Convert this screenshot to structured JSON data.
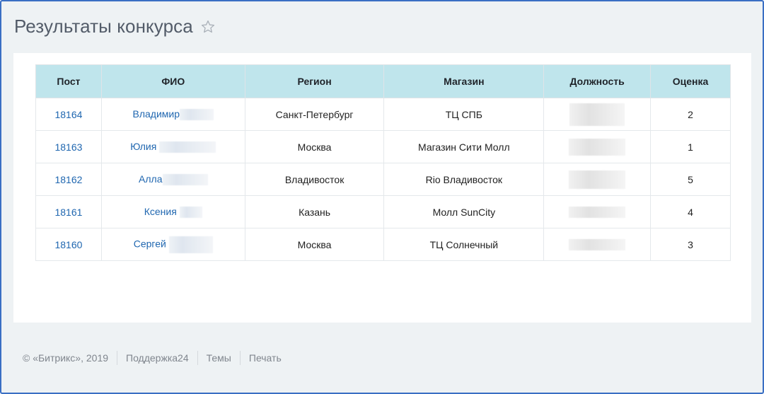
{
  "page": {
    "title": "Результаты конкурса",
    "favorite_icon": "star-outline-icon"
  },
  "table": {
    "columns": [
      "Пост",
      "ФИО",
      "Регион",
      "Магазин",
      "Должность",
      "Оценка"
    ],
    "rows": [
      {
        "post": "18164",
        "name": "Владимир",
        "region": "Санкт-Петербург",
        "store": "ТЦ СПБ",
        "score": "2"
      },
      {
        "post": "18163",
        "name": "Юлия",
        "region": "Москва",
        "store": "Магазин Сити Молл",
        "score": "1"
      },
      {
        "post": "18162",
        "name": "Алла",
        "region": "Владивосток",
        "store": "Rio Владивосток",
        "score": "5"
      },
      {
        "post": "18161",
        "name": "Ксения",
        "region": "Казань",
        "store": "Молл SunCity",
        "score": "4"
      },
      {
        "post": "18160",
        "name": "Сергей",
        "region": "Москва",
        "store": "ТЦ Солнечный",
        "score": "3"
      }
    ]
  },
  "footer": {
    "copyright": "© «Битрикс», 2019",
    "support": "Поддержка24",
    "themes": "Темы",
    "print": "Печать"
  },
  "colors": {
    "frame_border": "#3a6fc4",
    "header_bg": "#bfe5ec",
    "link": "#2067b0",
    "page_bg": "#eef2f4"
  }
}
